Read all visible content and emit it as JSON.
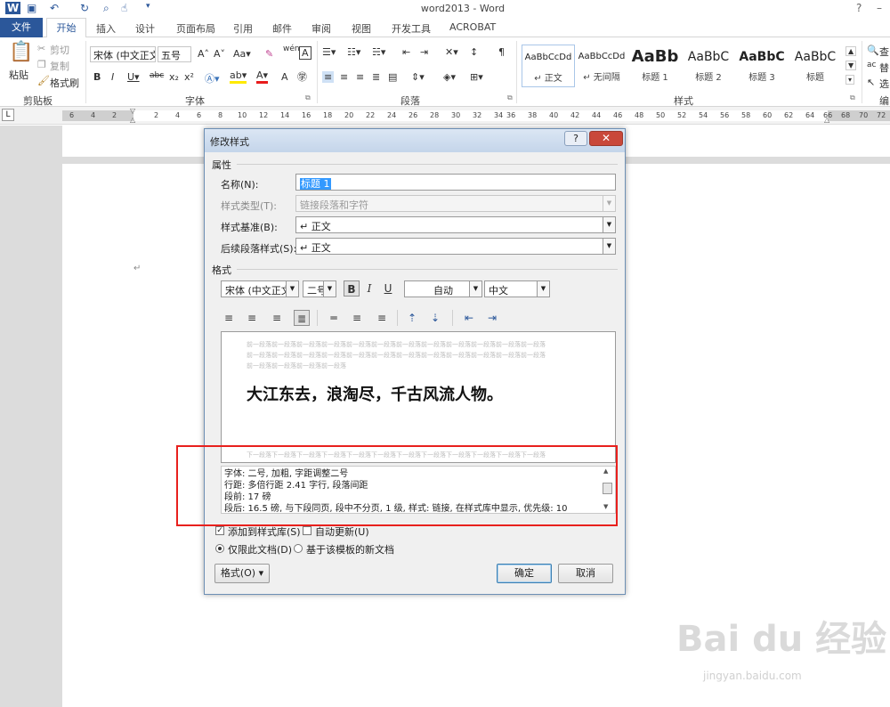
{
  "window": {
    "title": "word2013 - Word",
    "help": "?",
    "minimize": "–"
  },
  "tabs": [
    "文件",
    "开始",
    "插入",
    "设计",
    "页面布局",
    "引用",
    "邮件",
    "审阅",
    "视图",
    "开发工具",
    "ACROBAT"
  ],
  "ribbon": {
    "clipboard": {
      "paste": "粘贴",
      "cut": "剪切",
      "copy": "复制",
      "format_painter": "格式刷",
      "label": "剪贴板"
    },
    "font": {
      "font_name": "宋体 (中文正文",
      "font_size": "五号",
      "label": "字体"
    },
    "paragraph": {
      "label": "段落"
    },
    "styles": {
      "label": "样式",
      "items": [
        {
          "preview": "AaBbCcDd",
          "name": "↵ 正文"
        },
        {
          "preview": "AaBbCcDd",
          "name": "↵ 无间隔"
        },
        {
          "preview": "AaBb",
          "name": "标题 1"
        },
        {
          "preview": "AaBbC",
          "name": "标题 2"
        },
        {
          "preview": "AaBbC",
          "name": "标题 3"
        },
        {
          "preview": "AaBbC",
          "name": "标题"
        }
      ]
    },
    "editing": {
      "find": "查",
      "replace": "替",
      "select": "选",
      "label": "编"
    }
  },
  "ruler": {
    "numbers": [
      "6",
      "4",
      "2",
      "2",
      "4",
      "6",
      "8",
      "10",
      "12",
      "14",
      "16",
      "18",
      "20",
      "22",
      "24",
      "26",
      "28",
      "30",
      "32",
      "34",
      "36",
      "38",
      "40",
      "42",
      "44",
      "46",
      "48",
      "50",
      "52",
      "54",
      "56",
      "58",
      "60",
      "62",
      "64",
      "66",
      "68",
      "70",
      "72"
    ]
  },
  "dialog": {
    "title": "修改样式",
    "help_button": "?",
    "close_button": "✕",
    "properties_section": "属性",
    "name_label": "名称(N):",
    "name_value": "标题 1",
    "style_type_label": "样式类型(T):",
    "style_type_value": "链接段落和字符",
    "style_based_label": "样式基准(B):",
    "style_based_value": "↵ 正文",
    "next_style_label": "后续段落样式(S):",
    "next_style_value": "↵ 正文",
    "format_section": "格式",
    "font_value": "宋体 (中文正文)",
    "size_value": "二号",
    "bold_glyph": "B",
    "italic_glyph": "I",
    "underline_glyph": "U",
    "color_value": "自动",
    "lang_value": "中文",
    "preview_prev_lines": [
      "前一段落前一段落前一段落前一段落前一段落前一段落前一段落前一段落前一段落前一段落前一段落前一段落",
      "前一段落前一段落前一段落前一段落前一段落前一段落前一段落前一段落前一段落前一段落前一段落前一段落",
      "前一段落前一段落前一段落前一段落"
    ],
    "preview_text": "大江东去，浪淘尽，千古风流人物。",
    "preview_next_line": "下一段落下一段落下一段落下一段落下一段落下一段落下一段落下一段落下一段落下一段落下一段落下一段落",
    "description_lines": [
      "字体: 二号, 加粗, 字距调整二号",
      "    行距: 多倍行距 2.41 字行, 段落间距",
      "    段前: 17 磅",
      "    段后: 16.5 磅, 与下段同页, 段中不分页, 1 级, 样式: 链接, 在样式库中显示, 优先级: 10"
    ],
    "add_to_gallery": "添加到样式库(S)",
    "auto_update": "自动更新(U)",
    "only_this_doc": "仅限此文档(D)",
    "new_docs_template": "基于该模板的新文档",
    "format_button": "格式(O) ▾",
    "ok_button": "确定",
    "cancel_button": "取消"
  },
  "watermark": {
    "main": "Bai du 经验",
    "sub": "jingyan.baidu.com"
  },
  "colors": {
    "accent": "#2b579a",
    "highlight": "#e8201d"
  }
}
